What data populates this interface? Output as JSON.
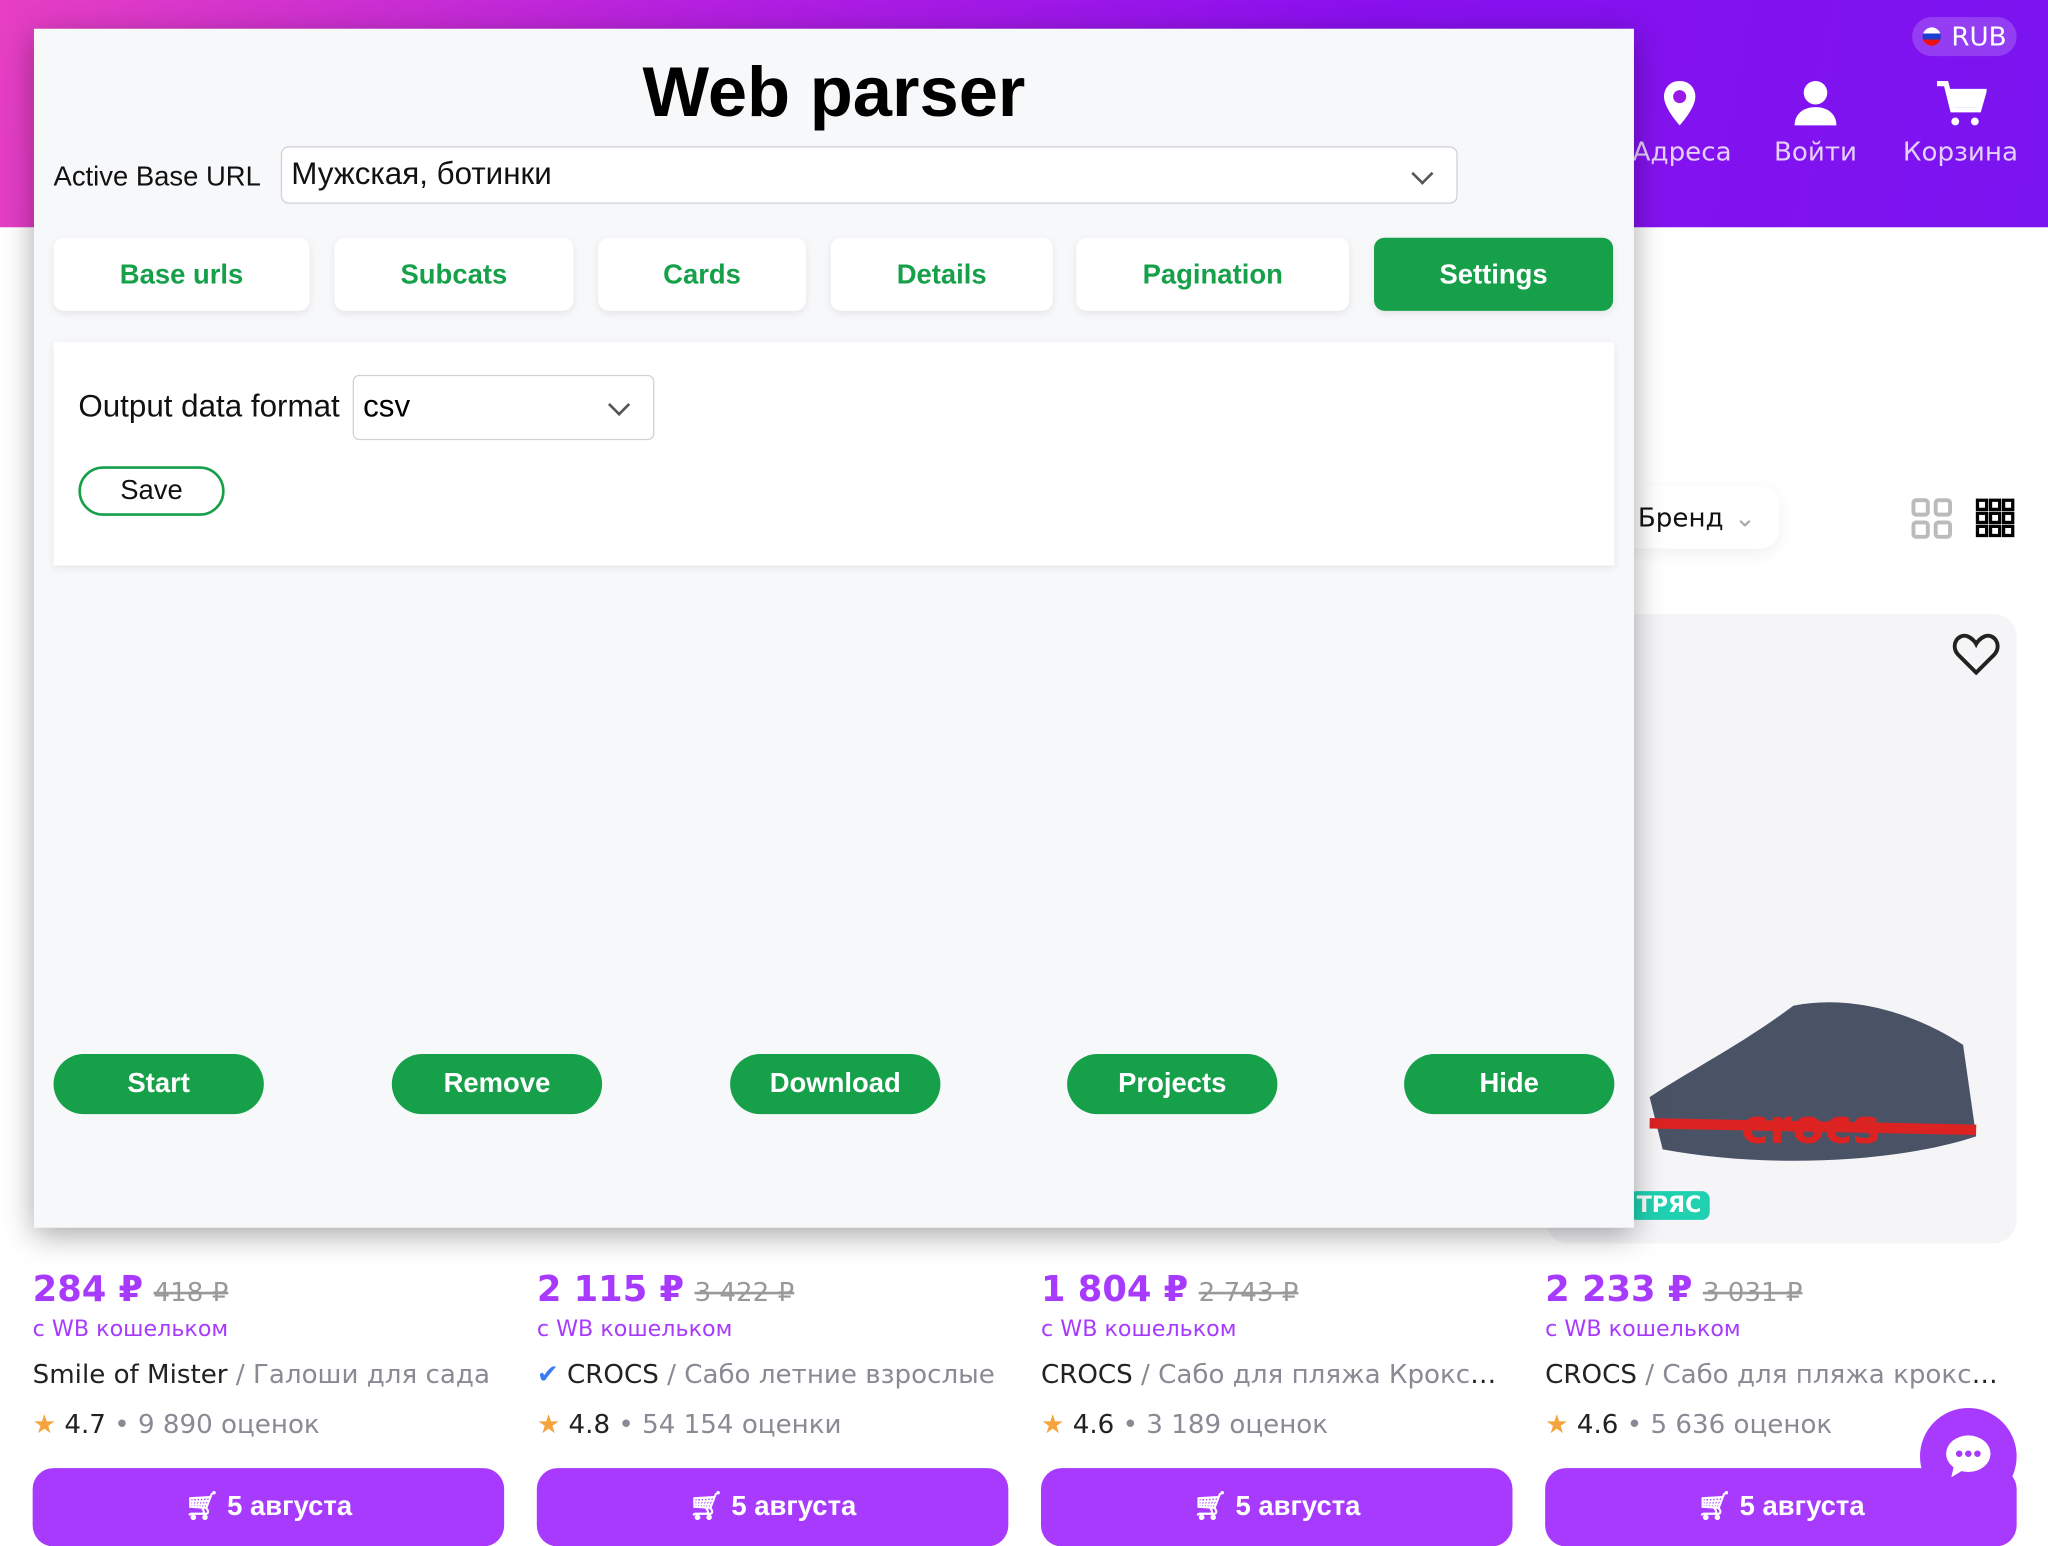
{
  "site": {
    "currency": "RUB",
    "nav": [
      {
        "label": "Адреса",
        "icon": "location-pin-icon"
      },
      {
        "label": "Войти",
        "icon": "user-icon"
      },
      {
        "label": "Корзина",
        "icon": "cart-icon"
      }
    ],
    "filter": "Бренд",
    "badge": "ТРЯС",
    "products": [
      {
        "price": "284 ₽",
        "old": "418 ₽",
        "wallet": "с WB кошельком",
        "brand": "Smile of Mister",
        "title": " / Галоши для сада",
        "rating": "4.7",
        "reviews": " • 9 890 оценок",
        "delivery": "5 августа",
        "verified": false
      },
      {
        "price": "2 115 ₽",
        "old": "3 422 ₽",
        "wallet": "с WB кошельком",
        "brand": "CROCS",
        "title": " / Сабо летние взрослые",
        "rating": "4.8",
        "reviews": " • 54 154 оценки",
        "delivery": "5 августа",
        "verified": true
      },
      {
        "price": "1 804 ₽",
        "old": "2 743 ₽",
        "wallet": "с WB кошельком",
        "brand": "CROCS",
        "title": " / Сабо для пляжа Кроксы ...",
        "rating": "4.6",
        "reviews": " • 3 189 оценок",
        "delivery": "5 августа",
        "verified": false
      },
      {
        "price": "2 233 ₽",
        "old": "3 031 ₽",
        "wallet": "с WB кошельком",
        "brand": "CROCS",
        "title": " / Сабо для пляжа кроксы ...",
        "rating": "4.6",
        "reviews": " • 5 636 оценок",
        "delivery": "5 августа",
        "verified": false
      }
    ],
    "colors": {
      "brand": "#a73afd",
      "accent": "#17a04a"
    }
  },
  "parser": {
    "title": "Web parser",
    "base_url_label": "Active Base URL",
    "base_url_value": "Мужская, ботинки",
    "tabs": [
      {
        "label": "Base urls"
      },
      {
        "label": "Subcats"
      },
      {
        "label": "Cards"
      },
      {
        "label": "Details"
      },
      {
        "label": "Pagination"
      },
      {
        "label": "Settings",
        "active": true
      }
    ],
    "settings": {
      "format_label": "Output data format",
      "format_value": "csv",
      "save": "Save"
    },
    "actions": [
      {
        "label": "Start"
      },
      {
        "label": "Remove"
      },
      {
        "label": "Download"
      },
      {
        "label": "Projects"
      },
      {
        "label": "Hide"
      }
    ]
  }
}
